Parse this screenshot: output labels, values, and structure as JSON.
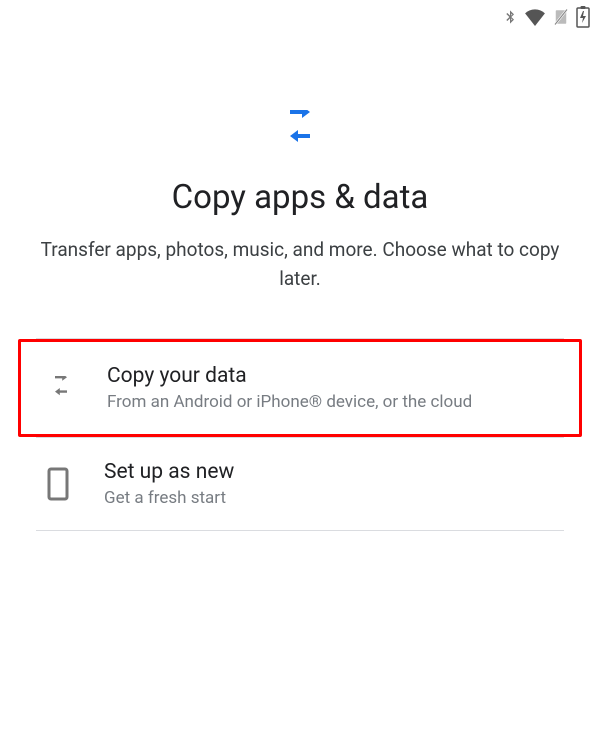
{
  "statusbar": {
    "icons": [
      "bluetooth-icon",
      "wifi-icon",
      "no-sim-icon",
      "battery-charging-icon"
    ]
  },
  "hero": {
    "title": "Copy apps & data",
    "subtitle": "Transfer apps, photos, music, and more. Choose what to copy later."
  },
  "options": [
    {
      "id": "copy",
      "title": "Copy your data",
      "subtitle": "From an Android or iPhone® device, or the cloud",
      "icon": "transfer-arrows-icon",
      "highlighted": true
    },
    {
      "id": "new",
      "title": "Set up as new",
      "subtitle": "Get a fresh start",
      "icon": "phone-outline-icon",
      "highlighted": false
    }
  ],
  "colors": {
    "accent": "#1a73e8",
    "highlight_border": "#ff0000",
    "icon_gray": "#777777"
  }
}
